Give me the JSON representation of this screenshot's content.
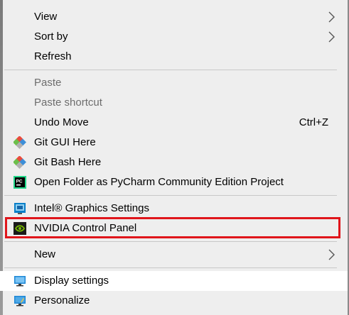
{
  "menu": {
    "items": [
      {
        "label": "View",
        "submenu": true,
        "icon": null,
        "enabled": true
      },
      {
        "label": "Sort by",
        "submenu": true,
        "icon": null,
        "enabled": true
      },
      {
        "label": "Refresh",
        "submenu": false,
        "icon": null,
        "enabled": true
      },
      {
        "label": "Paste",
        "submenu": false,
        "icon": null,
        "enabled": false
      },
      {
        "label": "Paste shortcut",
        "submenu": false,
        "icon": null,
        "enabled": false
      },
      {
        "label": "Undo Move",
        "shortcut": "Ctrl+Z",
        "submenu": false,
        "icon": null,
        "enabled": true
      },
      {
        "label": "Git GUI Here",
        "submenu": false,
        "icon": "git-diamond-icon",
        "enabled": true
      },
      {
        "label": "Git Bash Here",
        "submenu": false,
        "icon": "git-diamond-icon",
        "enabled": true
      },
      {
        "label": "Open Folder as PyCharm Community Edition Project",
        "submenu": false,
        "icon": "pycharm-icon",
        "enabled": true
      },
      {
        "label": "Intel® Graphics Settings",
        "submenu": false,
        "icon": "intel-graphics-icon",
        "enabled": true
      },
      {
        "label": "NVIDIA Control Panel",
        "submenu": false,
        "icon": "nvidia-icon",
        "enabled": true,
        "outlined": true
      },
      {
        "label": "New",
        "submenu": true,
        "icon": null,
        "enabled": true
      },
      {
        "label": "Display settings",
        "submenu": false,
        "icon": "display-icon",
        "enabled": true,
        "hovered": true
      },
      {
        "label": "Personalize",
        "submenu": false,
        "icon": "personalize-icon",
        "enabled": true
      }
    ]
  },
  "colors": {
    "menu_bg": "#eeeeee",
    "hover_bg": "#ffffff",
    "disabled_text": "#6d6d6d",
    "highlight_border": "#e0151b"
  }
}
